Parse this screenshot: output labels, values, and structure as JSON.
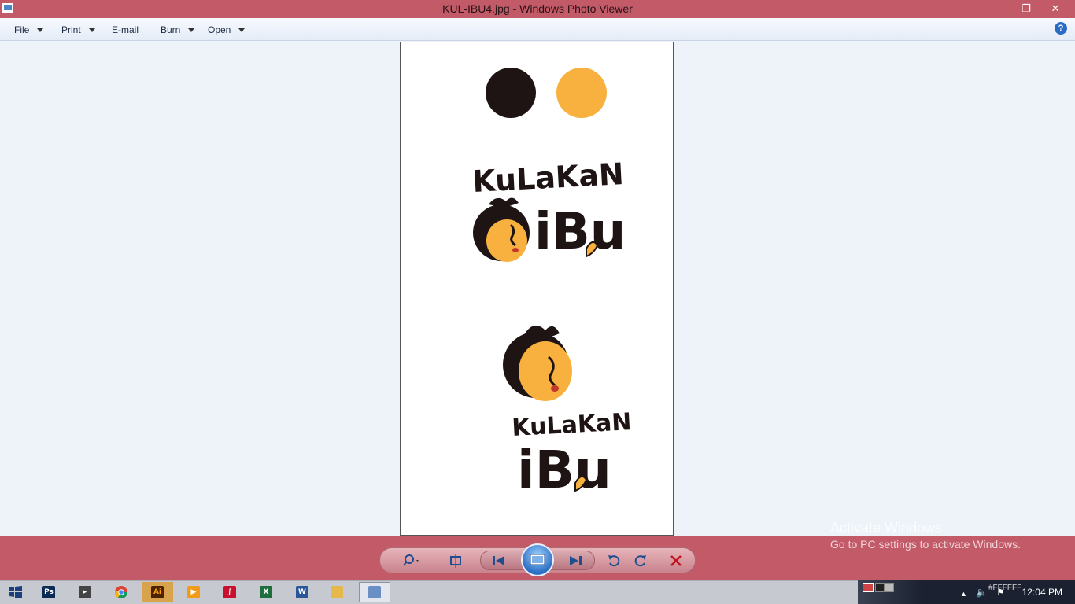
{
  "window": {
    "title": "KUL-IBU4.jpg - Windows Photo Viewer",
    "minimize_icon": "minimize-icon",
    "restore_icon": "restore-icon",
    "close_icon": "close-icon"
  },
  "menu": {
    "items": [
      {
        "label": "File",
        "has_dropdown": true
      },
      {
        "label": "Print",
        "has_dropdown": true
      },
      {
        "label": "E-mail",
        "has_dropdown": false
      },
      {
        "label": "Burn",
        "has_dropdown": true
      },
      {
        "label": "Open",
        "has_dropdown": true
      }
    ],
    "help_label": "?"
  },
  "image": {
    "swatches": [
      "#1e1414",
      "#f8b03f"
    ],
    "logo_word1": "KuLaKaN",
    "logo_word2": "iBu"
  },
  "controls": {
    "icons": [
      "zoom-icon",
      "actual-size-icon",
      "previous-icon",
      "slideshow-icon",
      "next-icon",
      "rotate-counterclockwise-icon",
      "rotate-clockwise-icon",
      "delete-icon"
    ]
  },
  "watermark": {
    "heading": "Activate Windows",
    "subtext": "Go to PC settings to activate Windows."
  },
  "taskbar": {
    "apps": [
      {
        "name": "photoshop",
        "label": "Ps",
        "color": "#0b2a55"
      },
      {
        "name": "media-center",
        "label": "",
        "color": "#444"
      },
      {
        "name": "chrome",
        "label": "",
        "color": "#db4437"
      },
      {
        "name": "illustrator",
        "label": "Ai",
        "color": "#4a2300"
      },
      {
        "name": "media-player",
        "label": "",
        "color": "#f29b1b"
      },
      {
        "name": "acrobat",
        "label": "",
        "color": "#c8102e"
      },
      {
        "name": "excel",
        "label": "X",
        "color": "#1d6e3c"
      },
      {
        "name": "word",
        "label": "W",
        "color": "#2b579a"
      },
      {
        "name": "file-explorer",
        "label": "",
        "color": "#e6b84c"
      },
      {
        "name": "photo-viewer",
        "label": "",
        "color": "#6a8fc4"
      }
    ],
    "tray_text": "#FFFFFF",
    "time": "12:04 PM"
  }
}
